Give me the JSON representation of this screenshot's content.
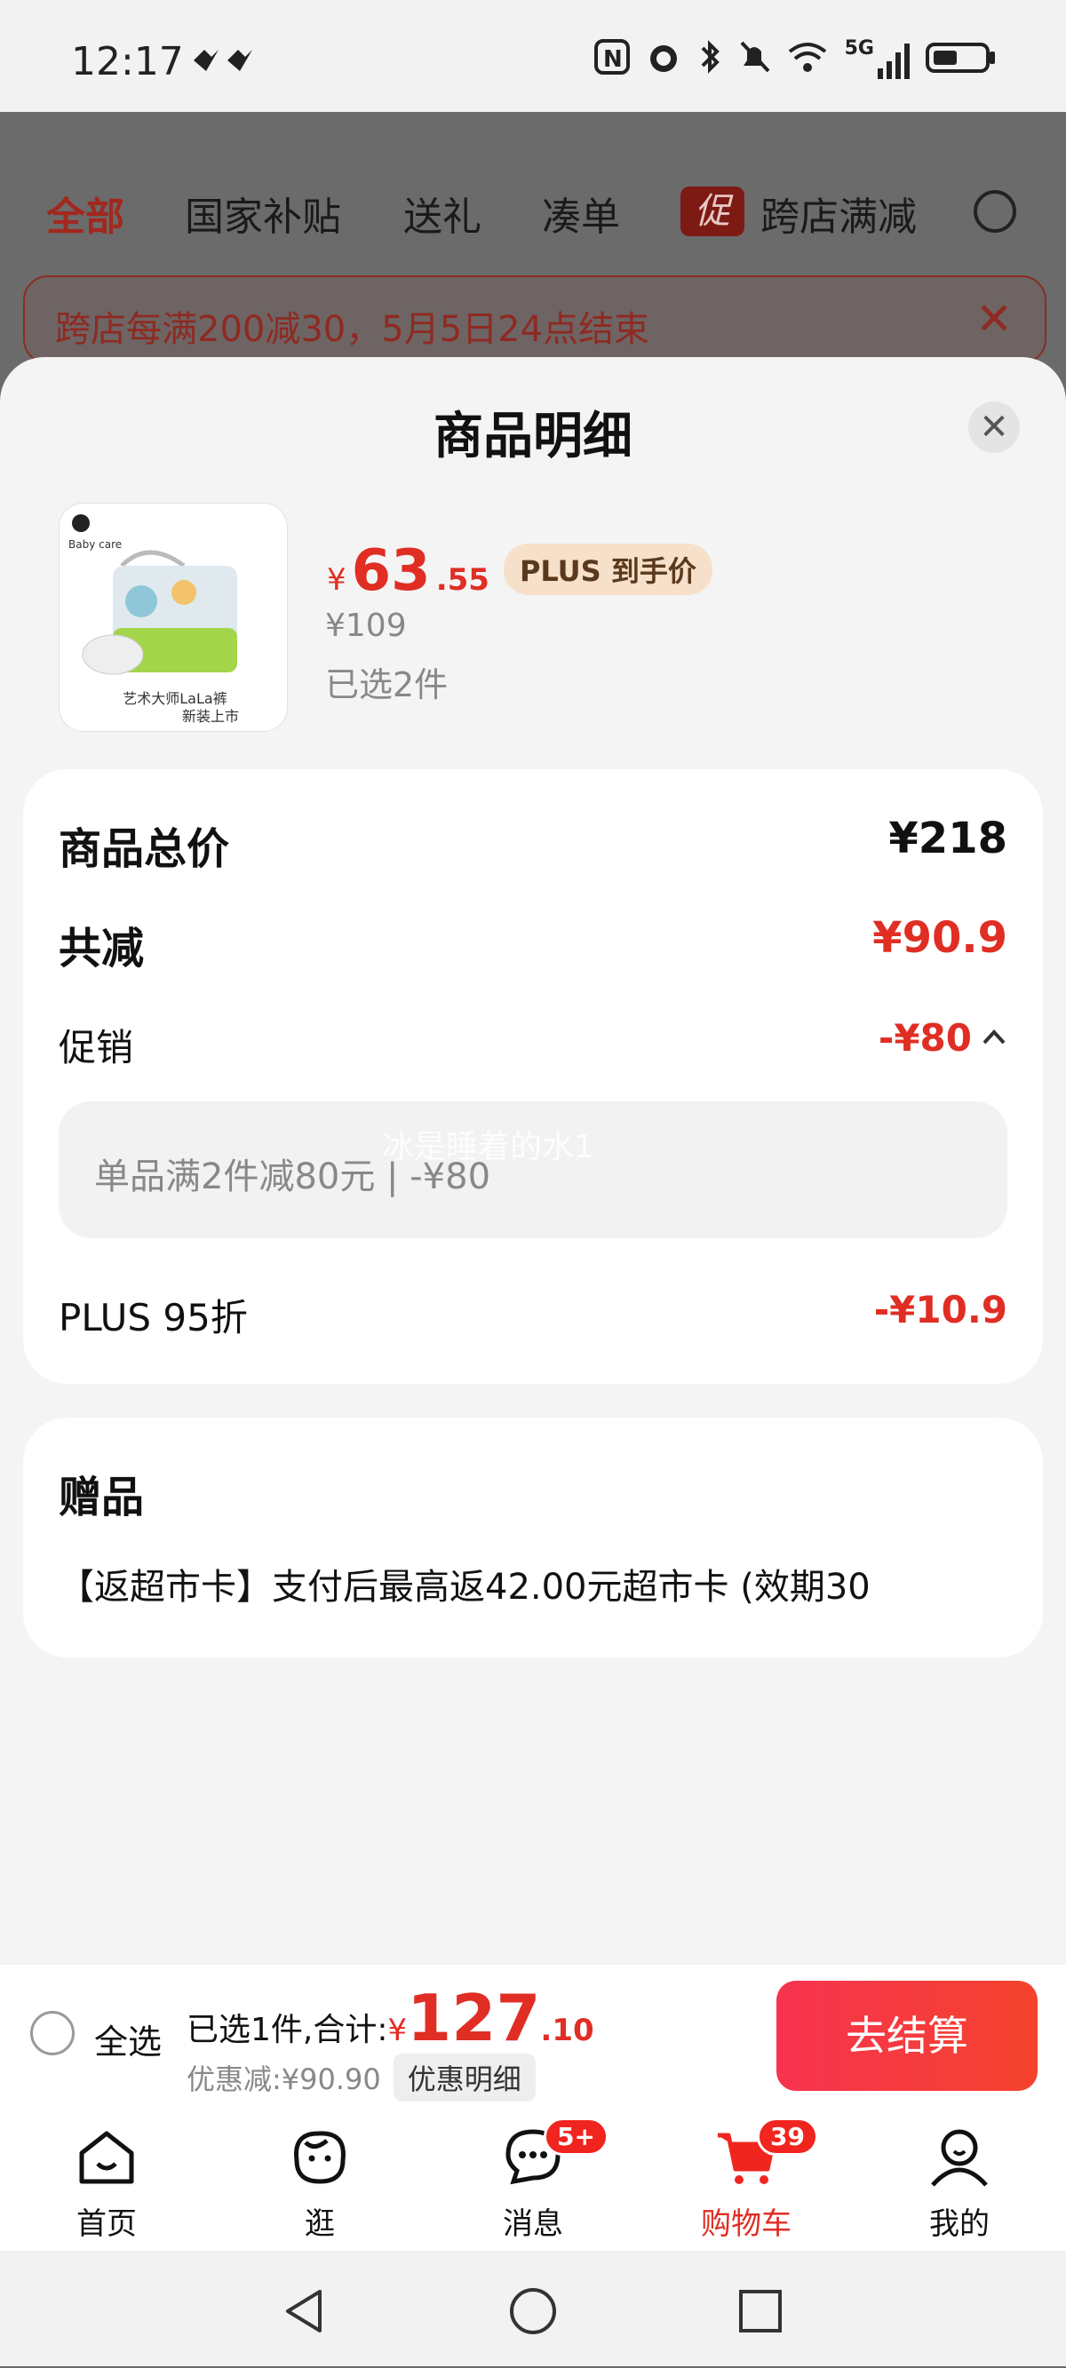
{
  "status_bar": {
    "time": "12:17",
    "network": "5G",
    "icons": [
      "heart-wave-icon",
      "nfc-icon",
      "alarm-icon",
      "bluetooth-icon",
      "mute-icon",
      "wifi-icon",
      "signal-icon",
      "battery-icon"
    ]
  },
  "background": {
    "tabs": [
      "全部",
      "国家补贴",
      "送礼",
      "凑单",
      "跨店满减"
    ],
    "promo_tag": "促",
    "banner": "跨店每满200减30，5月5日24点结束"
  },
  "sheet": {
    "title": "商品明细",
    "product": {
      "price_yen": "¥",
      "price_int": "63",
      "price_dec": ".55",
      "plus_badge": "PLUS 到手价",
      "original_price": "¥109",
      "selected": "已选2件",
      "thumb_brand": "Baby care",
      "thumb_caption_1": "艺术大师LaLa裤",
      "thumb_caption_2": "新装上市"
    },
    "summary": {
      "total_label": "商品总价",
      "total_value": "¥218",
      "reduce_label": "共减",
      "reduce_value": "¥90.9",
      "promo_label": "促销",
      "promo_value": "-¥80",
      "promo_detail": "单品满2件减80元 | -¥80",
      "plus_label": "PLUS 95折",
      "plus_value": "-¥10.9"
    },
    "watermark": "冰是睡着的水1",
    "gift": {
      "title": "赠品",
      "text": "【返超市卡】支付后最高返42.00元超市卡 (效期30"
    }
  },
  "checkout": {
    "select_all": "全选",
    "selected_summary": "已选1件,合计:",
    "total_yen": "¥",
    "total_int": "127",
    "total_dec": ".10",
    "discount": "优惠减:¥90.90",
    "detail_button": "优惠明细",
    "checkout_button": "去结算"
  },
  "tabbar": {
    "items": [
      {
        "label": "首页",
        "icon": "home-icon"
      },
      {
        "label": "逛",
        "icon": "browse-face-icon"
      },
      {
        "label": "消息",
        "icon": "message-icon",
        "badge": "5+"
      },
      {
        "label": "购物车",
        "icon": "cart-icon",
        "badge": "39"
      },
      {
        "label": "我的",
        "icon": "profile-icon"
      }
    ]
  },
  "colors": {
    "accent": "#e02e24",
    "checkout_btn": "#f4432d",
    "plus_badge_bg": "#f7e0c9"
  }
}
